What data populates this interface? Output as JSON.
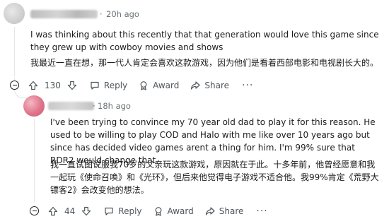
{
  "comments": [
    {
      "username": "",
      "separator": "·",
      "timestamp": "20h ago",
      "text_en": "I was thinking about this recently that that generation would love this game since they grew up with cowboy movies and shows",
      "text_zh": "我最近一直在想，那一代人肯定会喜欢这款游戏，因为他们是看着西部电影和电视剧长大的。",
      "votes": "130",
      "actions": {
        "reply": "Reply",
        "award": "Award",
        "share": "Share",
        "more": "···"
      }
    },
    {
      "username": "",
      "separator": "·",
      "timestamp": "18h ago",
      "text_en": "I've been trying to convince my 70 year old dad to play it for this reason. He used to be willing to play COD and Halo with me like over 10 years ago but since has decided video games arent a thing for him. I'm 99% sure that RDR2 would change that.",
      "text_zh": "我一直试图说服我70岁的父亲玩这款游戏，原因就在于此。十多年前，他曾经愿意和我一起玩《使命召唤》和《光环》，但后来他觉得电子游戏不适合他。我99%肯定《荒野大镖客2》会改变他的想法。",
      "votes": "44",
      "actions": {
        "reply": "Reply",
        "award": "Award",
        "share": "Share",
        "more": "···"
      }
    }
  ],
  "icons": [
    "collapse-icon",
    "upvote-icon",
    "downvote-icon",
    "reply-icon",
    "award-icon",
    "share-icon",
    "more-icon"
  ]
}
